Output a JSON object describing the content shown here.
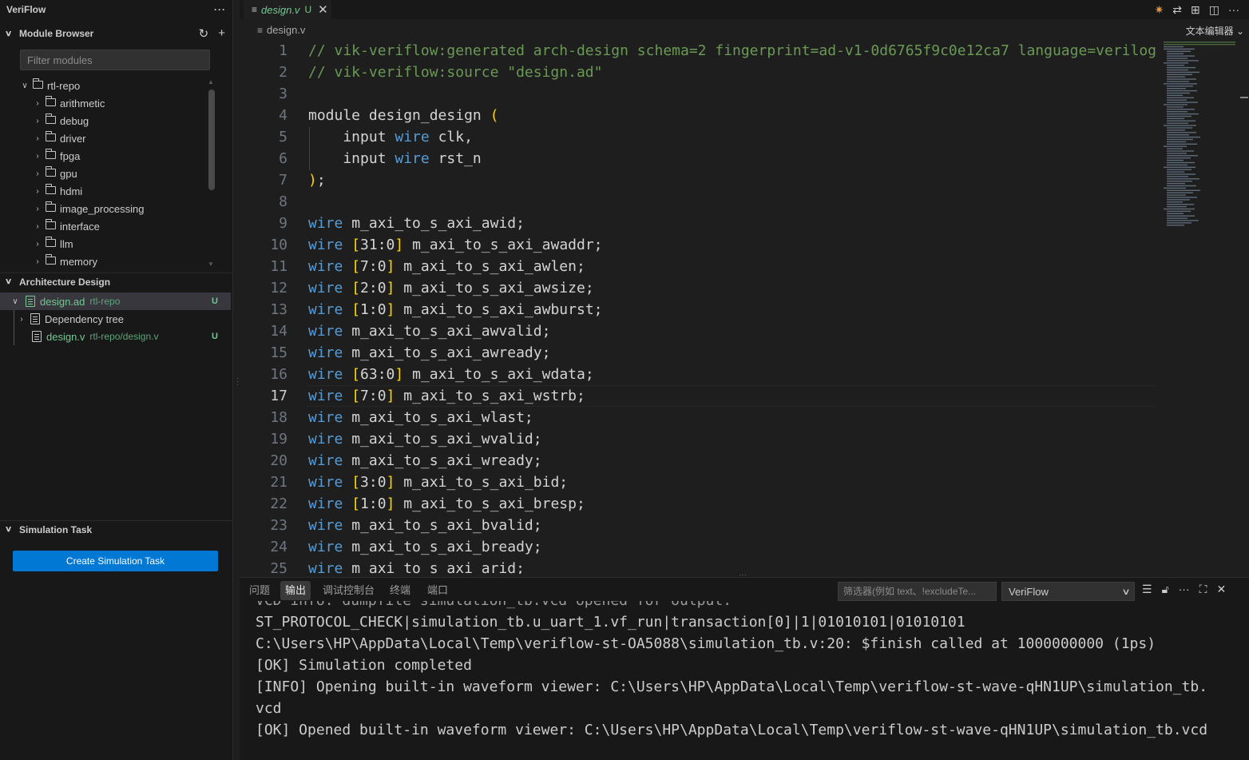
{
  "sidebar": {
    "title": "VeriFlow",
    "more": "···",
    "module_browser": {
      "title": "Module Browser",
      "filter_placeholder": "Filter modules",
      "root": "rtl-repo",
      "folders": [
        "arithmetic",
        "debug",
        "driver",
        "fpga",
        "gpu",
        "hdmi",
        "image_processing",
        "interface",
        "llm",
        "memory"
      ]
    },
    "architecture": {
      "title": "Architecture Design",
      "design_file": "design.ad",
      "design_repo": "rtl-repo",
      "design_badge": "U",
      "dependency_tree": "Dependency tree",
      "verilog_file": "design.v",
      "verilog_path": "rtl-repo/design.v",
      "verilog_badge": "U"
    },
    "simulation": {
      "title": "Simulation Task",
      "create_button": "Create Simulation Task"
    }
  },
  "editor": {
    "tab": {
      "name": "design.v",
      "badge": "U",
      "close": "✕"
    },
    "breadcrumb": "design.v",
    "view_label": "文本编辑器",
    "active_line": 17
  },
  "code_lines": [
    [
      {
        "t": "// vik-veriflow:generated arch-design schema=2 fingerprint=ad-v1-0d6765f9c0e12ca7 language=verilog",
        "c": "cm"
      }
    ],
    [
      {
        "t": "// vik-veriflow:source \"design.ad\"",
        "c": "cm"
      }
    ],
    [],
    [
      {
        "t": "module design_design "
      },
      {
        "t": "(",
        "c": "br"
      }
    ],
    [
      {
        "t": "    input "
      },
      {
        "t": "wire",
        "c": "kw"
      },
      {
        "t": " clk,"
      }
    ],
    [
      {
        "t": "    input "
      },
      {
        "t": "wire",
        "c": "kw"
      },
      {
        "t": " rst_n"
      }
    ],
    [
      {
        "t": ")",
        "c": "br"
      },
      {
        "t": ";"
      }
    ],
    [],
    [
      {
        "t": "wire",
        "c": "kw"
      },
      {
        "t": " m_axi_to_s_axi_awid;"
      }
    ],
    [
      {
        "t": "wire",
        "c": "kw"
      },
      {
        "t": " "
      },
      {
        "t": "[",
        "c": "br"
      },
      {
        "t": "31:0"
      },
      {
        "t": "]",
        "c": "br"
      },
      {
        "t": " m_axi_to_s_axi_awaddr;"
      }
    ],
    [
      {
        "t": "wire",
        "c": "kw"
      },
      {
        "t": " "
      },
      {
        "t": "[",
        "c": "br"
      },
      {
        "t": "7:0"
      },
      {
        "t": "]",
        "c": "br"
      },
      {
        "t": " m_axi_to_s_axi_awlen;"
      }
    ],
    [
      {
        "t": "wire",
        "c": "kw"
      },
      {
        "t": " "
      },
      {
        "t": "[",
        "c": "br"
      },
      {
        "t": "2:0"
      },
      {
        "t": "]",
        "c": "br"
      },
      {
        "t": " m_axi_to_s_axi_awsize;"
      }
    ],
    [
      {
        "t": "wire",
        "c": "kw"
      },
      {
        "t": " "
      },
      {
        "t": "[",
        "c": "br"
      },
      {
        "t": "1:0"
      },
      {
        "t": "]",
        "c": "br"
      },
      {
        "t": " m_axi_to_s_axi_awburst;"
      }
    ],
    [
      {
        "t": "wire",
        "c": "kw"
      },
      {
        "t": " m_axi_to_s_axi_awvalid;"
      }
    ],
    [
      {
        "t": "wire",
        "c": "kw"
      },
      {
        "t": " m_axi_to_s_axi_awready;"
      }
    ],
    [
      {
        "t": "wire",
        "c": "kw"
      },
      {
        "t": " "
      },
      {
        "t": "[",
        "c": "br"
      },
      {
        "t": "63:0"
      },
      {
        "t": "]",
        "c": "br"
      },
      {
        "t": " m_axi_to_s_axi_wdata;"
      }
    ],
    [
      {
        "t": "wire",
        "c": "kw"
      },
      {
        "t": " "
      },
      {
        "t": "[",
        "c": "br"
      },
      {
        "t": "7:0"
      },
      {
        "t": "]",
        "c": "br"
      },
      {
        "t": " m_axi_to_s_axi_wstrb;"
      }
    ],
    [
      {
        "t": "wire",
        "c": "kw"
      },
      {
        "t": " m_axi_to_s_axi_wlast;"
      }
    ],
    [
      {
        "t": "wire",
        "c": "kw"
      },
      {
        "t": " m_axi_to_s_axi_wvalid;"
      }
    ],
    [
      {
        "t": "wire",
        "c": "kw"
      },
      {
        "t": " m_axi_to_s_axi_wready;"
      }
    ],
    [
      {
        "t": "wire",
        "c": "kw"
      },
      {
        "t": " "
      },
      {
        "t": "[",
        "c": "br"
      },
      {
        "t": "3:0"
      },
      {
        "t": "]",
        "c": "br"
      },
      {
        "t": " m_axi_to_s_axi_bid;"
      }
    ],
    [
      {
        "t": "wire",
        "c": "kw"
      },
      {
        "t": " "
      },
      {
        "t": "[",
        "c": "br"
      },
      {
        "t": "1:0"
      },
      {
        "t": "]",
        "c": "br"
      },
      {
        "t": " m_axi_to_s_axi_bresp;"
      }
    ],
    [
      {
        "t": "wire",
        "c": "kw"
      },
      {
        "t": " m_axi_to_s_axi_bvalid;"
      }
    ],
    [
      {
        "t": "wire",
        "c": "kw"
      },
      {
        "t": " m_axi_to_s_axi_bready;"
      }
    ],
    [
      {
        "t": "wire",
        "c": "kw"
      },
      {
        "t": " m_axi_to_s_axi_arid;"
      }
    ]
  ],
  "panel": {
    "tabs": [
      "问题",
      "输出",
      "调试控制台",
      "终端",
      "端口"
    ],
    "active_tab": 1,
    "filter_placeholder": "筛选器(例如 text、!excludeTe...",
    "channel": "VeriFlow",
    "output_lines": [
      "VCD info: dumpfile simulation_tb.vcd opened for output.",
      "ST_PROTOCOL_CHECK|simulation_tb.u_uart_1.vf_run|transaction[0]|1|01010101|01010101",
      "C:\\Users\\HP\\AppData\\Local\\Temp\\veriflow-st-OA5088\\simulation_tb.v:20: $finish called at 1000000000 (1ps)",
      "[OK] Simulation completed",
      "[INFO] Opening built-in waveform viewer: C:\\Users\\HP\\AppData\\Local\\Temp\\veriflow-st-wave-qHN1UP\\simulation_tb.",
      "vcd",
      "[OK] Opened built-in waveform viewer: C:\\Users\\HP\\AppData\\Local\\Temp\\veriflow-st-wave-qHN1UP\\simulation_tb.vcd"
    ]
  },
  "colors": {
    "accent": "#0078d4",
    "untracked": "#73c991",
    "keyword": "#569cd6",
    "comment": "#6a9955",
    "bracket": "#ffd700"
  }
}
